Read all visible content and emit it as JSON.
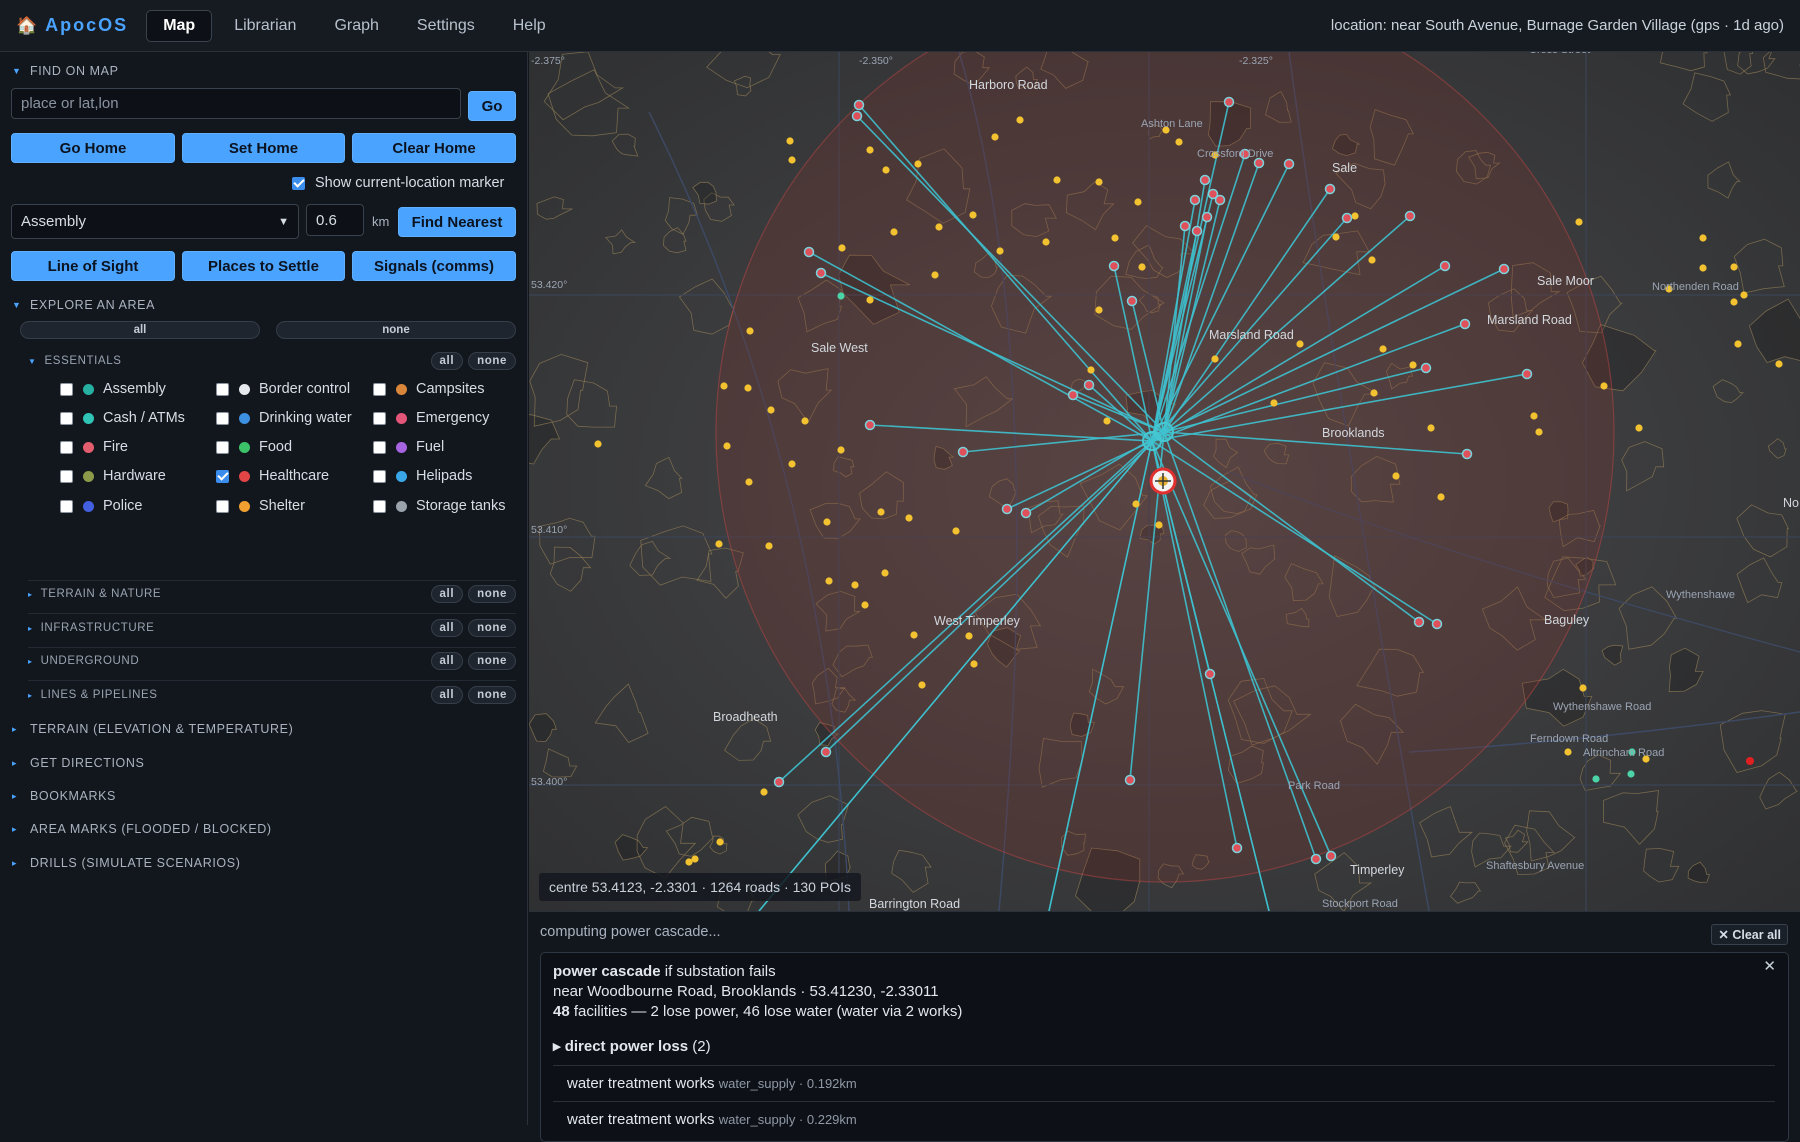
{
  "app": {
    "name": "ApocOS",
    "house_icon": "house-icon"
  },
  "nav": {
    "tabs": [
      "Map",
      "Librarian",
      "Graph",
      "Settings",
      "Help"
    ],
    "active": "Map"
  },
  "location_status": "location: near South Avenue, Burnage Garden Village (gps · 1d ago)",
  "find": {
    "title": "FIND ON MAP",
    "placeholder": "place or lat,lon",
    "go": "Go",
    "go_home": "Go Home",
    "set_home": "Set Home",
    "clear_home": "Clear Home",
    "show_marker": "Show current-location marker",
    "show_marker_checked": true,
    "category": "Assembly",
    "distance": "0.6",
    "unit": "km",
    "find_nearest": "Find Nearest",
    "line_of_sight": "Line of Sight",
    "places_to_settle": "Places to Settle",
    "signals": "Signals (comms)"
  },
  "explore": {
    "title": "EXPLORE AN AREA",
    "all": "all",
    "none": "none",
    "essentials": {
      "title": "ESSENTIALS",
      "items": [
        {
          "label": "Assembly",
          "color": "#26b0a1",
          "checked": false
        },
        {
          "label": "Border control",
          "color": "#e6e9ee",
          "checked": false
        },
        {
          "label": "Campsites",
          "color": "#d9863b",
          "checked": false
        },
        {
          "label": "Cash / ATMs",
          "color": "#2fc4b5",
          "checked": false
        },
        {
          "label": "Drinking water",
          "color": "#3d8fe0",
          "checked": false
        },
        {
          "label": "Emergency",
          "color": "#e4557a",
          "checked": false
        },
        {
          "label": "Fire",
          "color": "#e25d6e",
          "checked": false
        },
        {
          "label": "Food",
          "color": "#3cc36a",
          "checked": false
        },
        {
          "label": "Fuel",
          "color": "#a764e0",
          "checked": false
        },
        {
          "label": "Hardware",
          "color": "#8c9a4a",
          "checked": false
        },
        {
          "label": "Healthcare",
          "color": "#e24545",
          "checked": true
        },
        {
          "label": "Helipads",
          "color": "#3aa8e8",
          "checked": false
        },
        {
          "label": "Police",
          "color": "#4360e0",
          "checked": false
        },
        {
          "label": "Shelter",
          "color": "#f0a030",
          "checked": false
        },
        {
          "label": "Storage tanks",
          "color": "#9aa2ac",
          "checked": false
        }
      ]
    },
    "subsections": [
      "TERRAIN & NATURE",
      "INFRASTRUCTURE",
      "UNDERGROUND",
      "LINES & PIPELINES"
    ]
  },
  "collapsed_sections": [
    "TERRAIN (ELEVATION & TEMPERATURE)",
    "GET DIRECTIONS",
    "BOOKMARKS",
    "AREA MARKS (FLOODED / BLOCKED)",
    "DRILLS (SIMULATE SCENARIOS)"
  ],
  "map": {
    "status": "centre 53.4123, -2.3301 · 1264 roads · 130 POIs",
    "place_labels": [
      "Harboro Road",
      "Ashton Lane",
      "Crossford Drive",
      "Sale",
      "Sale West",
      "Marsland Road",
      "Marsland Road",
      "Sale Moor",
      "Northenden Road",
      "Brooklands",
      "West Timperley",
      "Baguley",
      "Wythenshawe",
      "Wythenshawe Road",
      "Broadheath",
      "Park Road",
      "Altrincham Road",
      "Shaftesbury Avenue",
      "Timperley",
      "Barrington Road",
      "Stockport Road",
      "Cross Street",
      "Ferndown Road",
      "No"
    ],
    "lat_labels": [
      "53.420°",
      "53.410°",
      "53.400°"
    ],
    "lon_labels": [
      "-2.375°",
      "-2.350°",
      "-2.325°"
    ]
  },
  "cascade": {
    "computing": "computing power cascade...",
    "clear_all": "✕ Clear all",
    "close": "✕",
    "title_bold": "power cascade",
    "title_rest": " if substation fails",
    "location": "near Woodbourne Road, Brooklands · 53.41230, -2.33011",
    "count": "48",
    "summary": " facilities — 2 lose power, 46 lose water (water via 2 works)",
    "section_bold": "▸ direct power loss",
    "section_rest": " (2)",
    "rows": [
      {
        "name": "water treatment works",
        "meta": "water_supply · 0.192km"
      },
      {
        "name": "water treatment works",
        "meta": "water_supply · 0.229km"
      }
    ]
  }
}
